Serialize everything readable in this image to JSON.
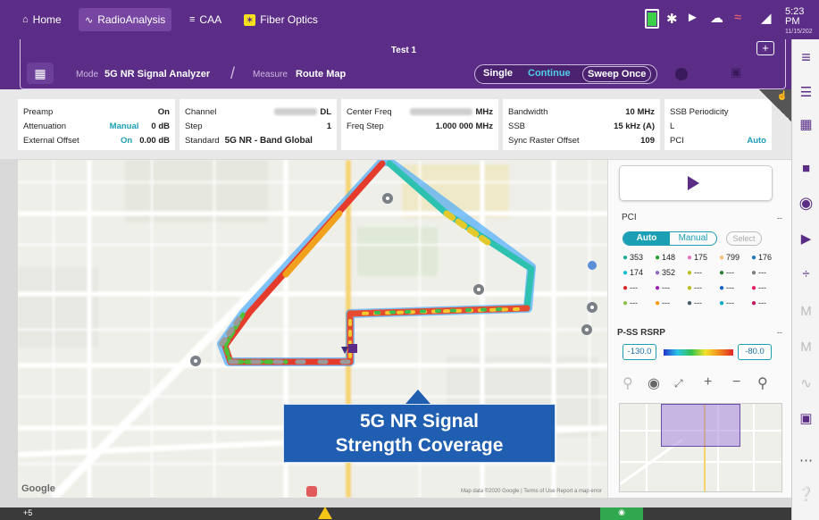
{
  "topbar": {
    "tabs": [
      {
        "label": "Home",
        "icon": "home-icon"
      },
      {
        "label": "RadioAnalysis",
        "icon": "pulse-icon"
      },
      {
        "label": "CAA",
        "icon": "caa-icon"
      },
      {
        "label": "Fiber Optics",
        "icon": "fiber-icon"
      }
    ],
    "clock": {
      "time": "5:23 PM",
      "date": "11/15/202"
    }
  },
  "header": {
    "test_title": "Test 1",
    "add_label": "+",
    "mode_label": "Mode",
    "mode_value": "5G NR Signal Analyzer",
    "measure_label": "Measure",
    "measure_value": "Route Map",
    "sweep": {
      "single": "Single",
      "continue": "Continue",
      "sweep_once": "Sweep Once"
    }
  },
  "params": {
    "col1": [
      {
        "label": "Preamp",
        "value": "On"
      },
      {
        "label": "Attenuation",
        "mode": "Manual",
        "value": "0 dB"
      },
      {
        "label": "External Offset",
        "mode": "On",
        "value": "0.00 dB"
      }
    ],
    "col2": [
      {
        "label": "Channel",
        "value": "DL"
      },
      {
        "label": "Step",
        "value": "1"
      },
      {
        "label": "Standard",
        "value": "5G NR - Band Global"
      }
    ],
    "col3": [
      {
        "label": "Center Freq",
        "value": "MHz"
      },
      {
        "label": "Freq Step",
        "value": "1.000 000 MHz"
      }
    ],
    "col4": [
      {
        "label": "Bandwidth",
        "value": "10 MHz"
      },
      {
        "label": "SSB",
        "value": "15 kHz (A)"
      },
      {
        "label": "Sync Raster Offset",
        "value": "109"
      }
    ],
    "col5": [
      {
        "label": "SSB Periodicity",
        "value": ""
      },
      {
        "label": "L",
        "value": ""
      },
      {
        "label": "PCI",
        "value": "Auto"
      }
    ]
  },
  "map": {
    "logo": "Google",
    "footer": "Map data ©2020 Google  |  Terms of Use   Report a map error",
    "callout_line1": "5G NR Signal",
    "callout_line2": "Strength Coverage"
  },
  "side": {
    "pci_title": "PCI",
    "pci_dash": "--",
    "auto": "Auto",
    "manual": "Manual",
    "select": "Select",
    "pci_items": [
      {
        "value": "353",
        "color": "#22aa99"
      },
      {
        "value": "148",
        "color": "#2ca02c"
      },
      {
        "value": "175",
        "color": "#e377c2"
      },
      {
        "value": "799",
        "color": "#ffbb78"
      },
      {
        "value": "176",
        "color": "#1f77b4"
      },
      {
        "value": "174",
        "color": "#17becf"
      },
      {
        "value": "352",
        "color": "#9467bd"
      },
      {
        "value": "---",
        "color": "#bcbd22"
      },
      {
        "value": "---",
        "color": "#2e7d32"
      },
      {
        "value": "---",
        "color": "#7f7f7f"
      },
      {
        "value": "---",
        "color": "#d62728"
      },
      {
        "value": "---",
        "color": "#9c27b0"
      },
      {
        "value": "---",
        "color": "#bcbd22"
      },
      {
        "value": "---",
        "color": "#1565c0"
      },
      {
        "value": "---",
        "color": "#e91e63"
      },
      {
        "value": "---",
        "color": "#8bc34a"
      },
      {
        "value": "---",
        "color": "#ff9800"
      },
      {
        "value": "---",
        "color": "#455a64"
      },
      {
        "value": "---",
        "color": "#00acc1"
      },
      {
        "value": "---",
        "color": "#c2185b"
      }
    ],
    "rsrp_title": "P-SS RSRP",
    "rsrp_dash": "--",
    "rsrp_min": "-130.0",
    "rsrp_max": "-80.0"
  },
  "bottom": {
    "count": "+5"
  }
}
